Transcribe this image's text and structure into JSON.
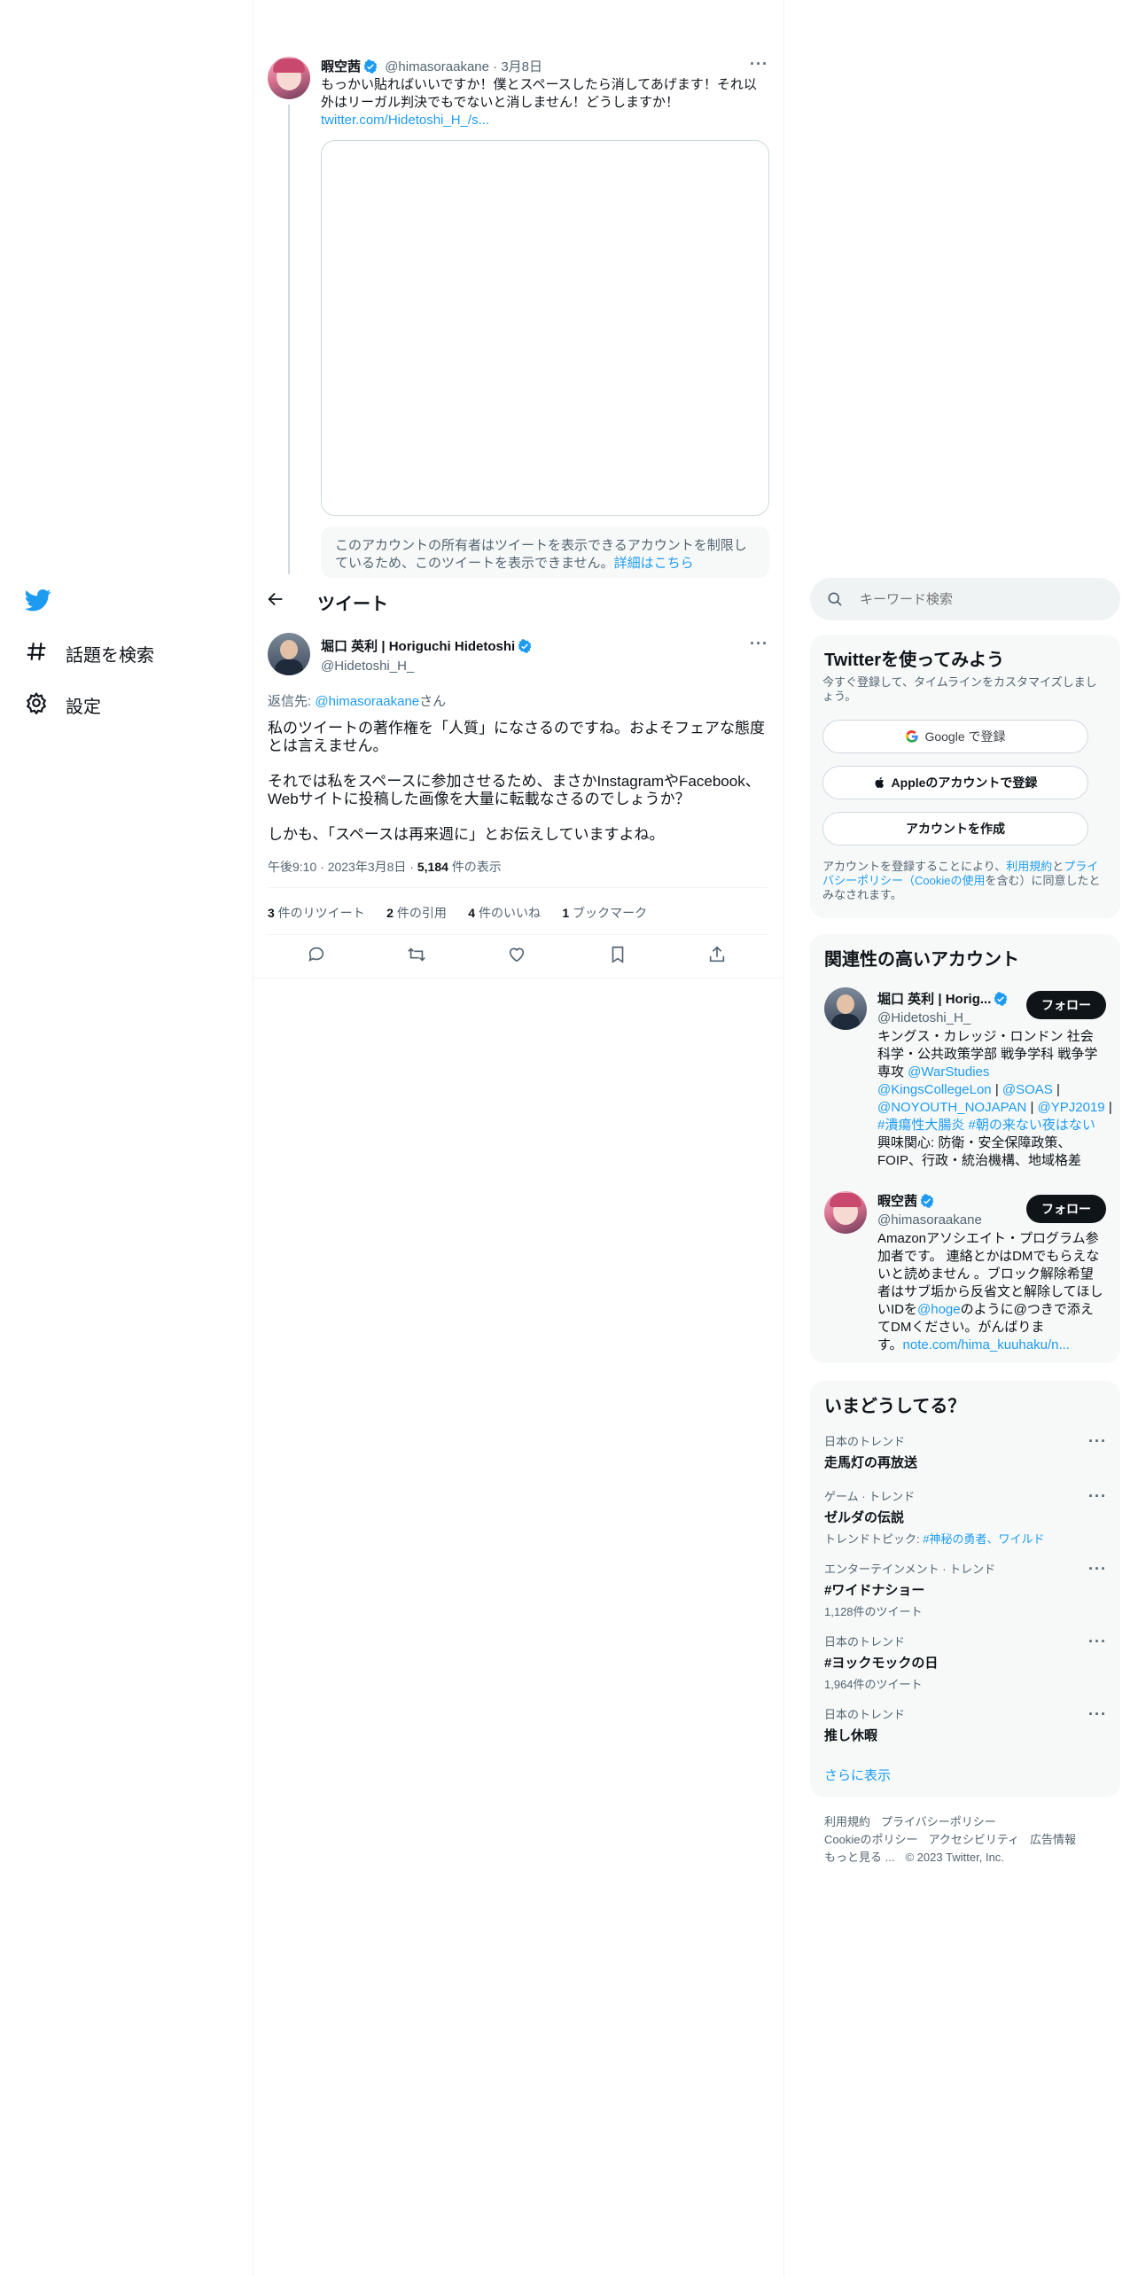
{
  "nav": {
    "explore_label": "話題を検索",
    "settings_label": "設定"
  },
  "quoted": {
    "display_name": "暇空茜",
    "handle": "@himasoraakane",
    "date": "3月8日",
    "text_line1": "もっかい貼ればいいですか！僕とスペースしたら消してあげます！それ以",
    "text_line2": "外はリーガル判決でもでないと消しません！どうしますか！",
    "link": "twitter.com/Hidetoshi_H_/s...",
    "notice_text": "このアカウントの所有者はツイートを表示できるアカウントを制限しているため、このツイートを表示できません。",
    "notice_link": "詳細はこちら"
  },
  "header": {
    "title": "ツイート"
  },
  "tweet": {
    "display_name": "堀口 英利 | Horiguchi Hidetoshi",
    "handle": "@Hidetoshi_H_",
    "reply_prefix": "返信先: ",
    "reply_handle": "@himasoraakane",
    "reply_suffix": "さん",
    "para1_line1": "私のツイートの著作権を「人質」になさるのですね。およそフェアな態度",
    "para1_line2": "とは言えません。",
    "para2_line1": "それでは私をスペースに参加させるため、まさかInstagramやFacebook、",
    "para2_line2": "Webサイトに投稿した画像を大量に転載なさるのでしょうか？",
    "para3": "しかも、「スペースは再来週に」とお伝えしていますよね。",
    "time": "午後9:10 · 2023年3月8日 · ",
    "views_count": "5,184",
    "views_label": " 件の表示",
    "retweets_count": "3",
    "retweets_label": " 件のリツイート",
    "quotes_count": "2",
    "quotes_label": " 件の引用",
    "likes_count": "4",
    "likes_label": " 件のいいね",
    "bookmarks_count": "1",
    "bookmarks_label": " ブックマーク"
  },
  "search": {
    "placeholder": "キーワード検索"
  },
  "signup": {
    "title": "Twitterを使ってみよう",
    "desc": "今すぐ登録して、タイムラインをカスタマイズしましょう。",
    "google_label": "Google で登録",
    "apple_label": "Appleのアカウントで登録",
    "create_label": "アカウントを作成",
    "legal_1": "アカウントを登録することにより、",
    "legal_tos": "利用規約",
    "legal_2": "と",
    "legal_pp": "プライバシーポリシー（Cookieの使用",
    "legal_3": "を含む）に同意したとみなされます。"
  },
  "related": {
    "title": "関連性の高いアカウント",
    "follow_label": "フォロー",
    "accounts": [
      {
        "name": "堀口 英利 | Horig...",
        "handle": "@Hidetoshi_H_",
        "bio_1": "キングス・カレッジ・ロンドン 社会",
        "bio_2": "科学・公共政策学部 戦争学科 戦争学",
        "bio_3a": "専攻 ",
        "bio_3b": "@WarStudies",
        "bio_4": "@KingsCollegeLon",
        "bio_4b": " | ",
        "bio_4c": "@SOAS",
        "bio_4d": " |",
        "bio_5": "@NOYOUTH_NOJAPAN",
        "bio_5b": " | ",
        "bio_5c": "@YPJ2019",
        "bio_5d": " |",
        "bio_6": "#潰瘍性大腸炎 #朝の来ない夜はない",
        "bio_7": "興味関心: 防衛・安全保障政策、",
        "bio_8": "FOIP、行政・統治機構、地域格差"
      },
      {
        "name": "暇空茜",
        "handle": "@himasoraakane",
        "bio_1": "Amazonアソシエイト・プログラム参",
        "bio_2": "加者です。 連絡とかはDMでもらえな",
        "bio_3": "いと読めません 。ブロック解除希望",
        "bio_4": "者はサブ垢から反省文と解除してほし",
        "bio_5a": "いIDを",
        "bio_5b": "@hoge",
        "bio_5c": "のように@つきで添え",
        "bio_6": "てDMください。がんばりま",
        "bio_7a": "す。",
        "bio_7b": "note.com/hima_kuuhaku/n..."
      }
    ]
  },
  "trends": {
    "title": "いまどうしてる？",
    "items": [
      {
        "meta": "日本のトレンド",
        "name": "走馬灯の再放送",
        "sub": ""
      },
      {
        "meta": "ゲーム · トレンド",
        "name": "ゼルダの伝説",
        "sub_prefix": "トレンドトピック: ",
        "sub_link": "#神秘の勇者、ワイルド"
      },
      {
        "meta": "エンターテインメント · トレンド",
        "name": "#ワイドナショー",
        "sub": "1,128件のツイート"
      },
      {
        "meta": "日本のトレンド",
        "name": "#ヨックモックの日",
        "sub": "1,964件のツイート"
      },
      {
        "meta": "日本のトレンド",
        "name": "推し休暇",
        "sub": ""
      }
    ],
    "show_more": "さらに表示"
  },
  "footer": {
    "tos": "利用規約",
    "privacy": "プライバシーポリシー",
    "cookie": "Cookieのポリシー",
    "accessibility": "アクセシビリティ",
    "ads": "広告情報",
    "more": "もっと見る ...",
    "copyright": "© 2023 Twitter, Inc."
  },
  "colors": {
    "accent": "#1d9bf0",
    "text": "#0f1419",
    "muted": "#536471",
    "border": "#eff3f4"
  }
}
